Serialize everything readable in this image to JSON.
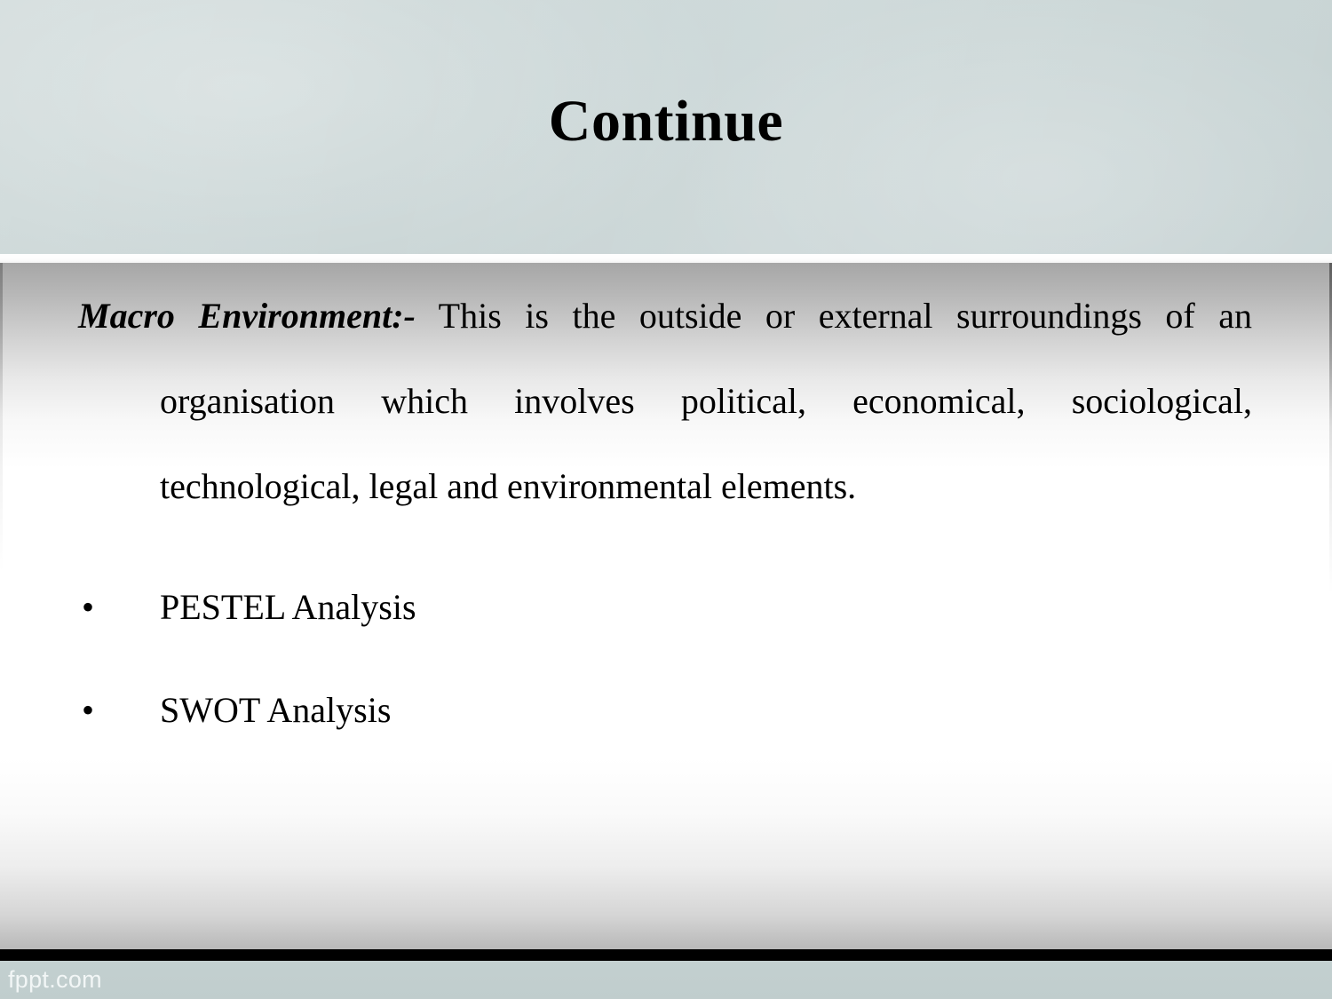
{
  "slide": {
    "title": "Continue",
    "body": {
      "lead_label": "Macro Environment:-",
      "lead_body": " This is the outside or external surroundings of an organisation which involves political, economical, sociological, technological, legal and environmental elements.",
      "bullet_marker": "•",
      "bullets": [
        {
          "label": "PESTEL Analysis"
        },
        {
          "label": "SWOT Analysis"
        }
      ]
    },
    "footer": {
      "watermark": "fppt.com"
    },
    "colors": {
      "header_band": "#ccd8d8",
      "footer_band": "#c3d0d0",
      "rule": "#000000",
      "text": "#000000",
      "watermark_text": "#f2f6f6"
    }
  }
}
